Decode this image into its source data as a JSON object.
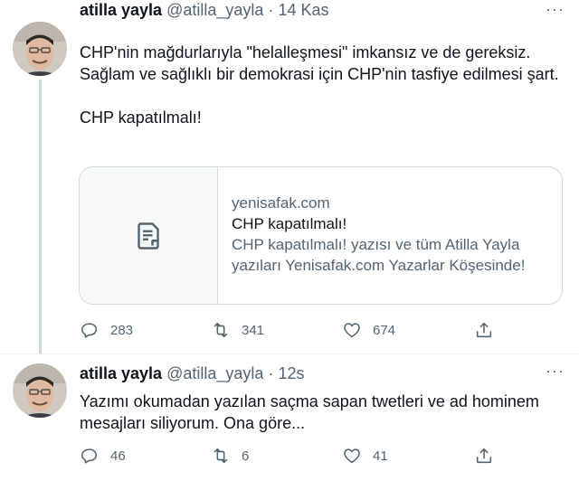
{
  "tweets": [
    {
      "author": "atilla yayla",
      "handle": "@atilla_yayla",
      "separator": "·",
      "time": "14 Kas",
      "more": "···",
      "paragraphs": [
        "CHP'nin mağdurlarıyla \"helalleşmesi\" imkansız ve de  gereksiz. Sağlam ve sağlıklı bir demokrasi için CHP'nin tasfiye edilmesi şart.",
        "CHP kapatılmalı!"
      ],
      "card": {
        "icon": "document-icon",
        "domain": "yenisafak.com",
        "title": "CHP kapatılmalı!",
        "description": "CHP kapatılmalı! yazısı ve tüm Atilla Yayla yazıları Yenisafak.com Yazarlar Köşesinde!"
      },
      "stats": {
        "replies": "283",
        "retweets": "341",
        "likes": "674"
      }
    },
    {
      "author": "atilla yayla",
      "handle": "@atilla_yayla",
      "separator": "·",
      "time": "12s",
      "more": "···",
      "paragraphs": [
        "Yazımı okumadan yazılan saçma sapan twetleri ve ad hominem mesajları siliyorum. Ona göre..."
      ],
      "stats": {
        "replies": "46",
        "retweets": "6",
        "likes": "41"
      }
    }
  ],
  "icons": {
    "reply": "reply-icon",
    "retweet": "retweet-icon",
    "like": "heart-icon",
    "share": "share-icon",
    "avatar": "avatar"
  },
  "colors": {
    "text": "#0f1419",
    "secondary": "#536471",
    "border": "#cfd9de",
    "divider": "#eff3f4"
  }
}
